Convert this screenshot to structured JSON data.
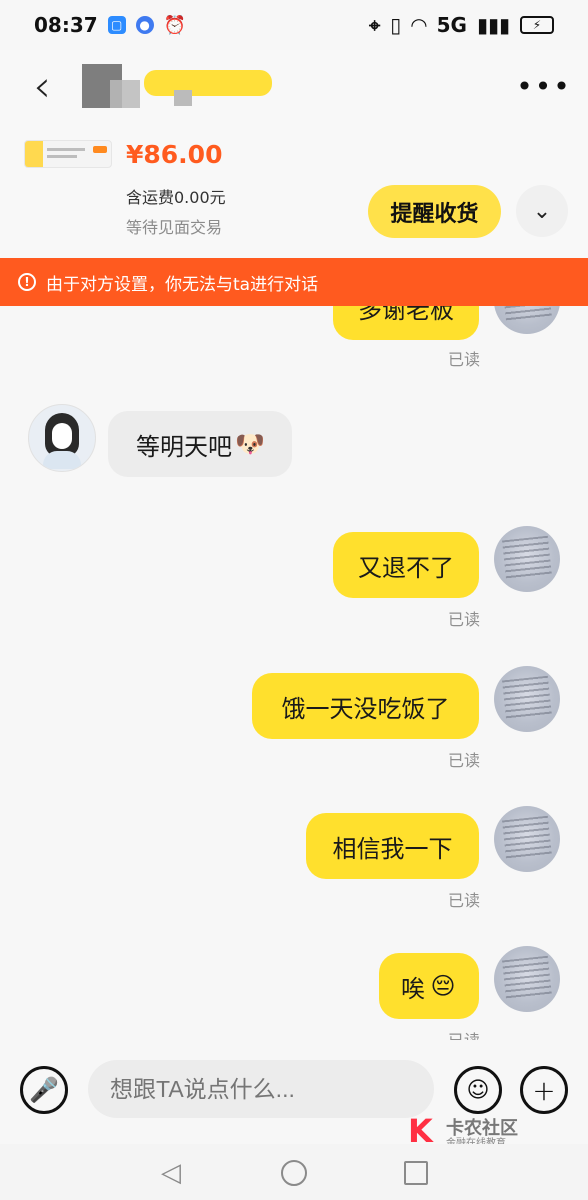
{
  "status_bar": {
    "time": "08:37",
    "network": "5G",
    "icons": [
      "message-icon",
      "globe-icon",
      "alarm-icon",
      "location-icon",
      "vibrate-icon",
      "wifi-icon",
      "signal-icon",
      "battery-icon"
    ]
  },
  "header": {
    "back_icon": "‹",
    "more_icon": "•••"
  },
  "order": {
    "price": "¥86.00",
    "shipping": "含运费0.00元",
    "status": "等待见面交易",
    "remind_button": "提醒收货",
    "expand_icon": "⌄"
  },
  "notice": {
    "text": "由于对方设置，你无法与ta进行对话",
    "icon": "!"
  },
  "messages": [
    {
      "text": "多谢老板",
      "read": "已读"
    },
    {
      "text": "等明天吧",
      "emoji": "🐶"
    },
    {
      "text": "又退不了",
      "read": "已读"
    },
    {
      "text": "饿一天没吃饭了",
      "read": "已读"
    },
    {
      "text": "相信我一下",
      "read": "已读"
    },
    {
      "text": "唉",
      "emoji": "😔",
      "read": "已读"
    }
  ],
  "composer": {
    "placeholder": "想跟TA说点什么...",
    "voice_icon": "🎤",
    "emoji_icon": "☺",
    "plus_icon": "+"
  },
  "watermark": {
    "title": "卡农社区",
    "subtitle": "金融在线教育"
  },
  "navigation": {
    "back_icon": "◁"
  }
}
